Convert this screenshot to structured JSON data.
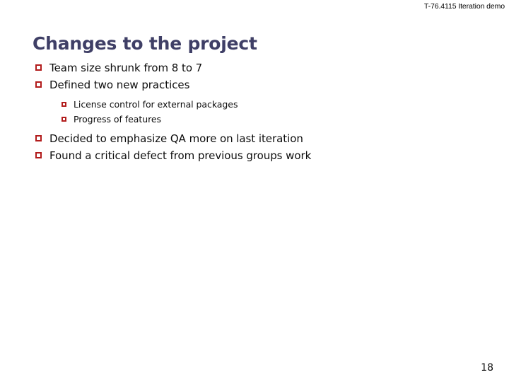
{
  "slide": {
    "header": "T-76.4115 Iteration demo",
    "title": "Changes to the project",
    "page_number": "18",
    "colors": {
      "title": "#3f3f66",
      "bullet_marker": "#b21c1c",
      "body_text": "#0d0d0d",
      "background": "#ffffff"
    },
    "bullets": [
      {
        "level": 1,
        "marker": "hollow-square",
        "text": "Team size shrunk from 8 to 7"
      },
      {
        "level": 1,
        "marker": "hollow-square",
        "text": "Defined two new practices"
      },
      {
        "level": 2,
        "marker": "hollow-square",
        "text": "License control for external packages"
      },
      {
        "level": 2,
        "marker": "hollow-square",
        "text": "Progress of features"
      },
      {
        "level": 1,
        "marker": "hollow-square",
        "text": "Decided to emphasize QA more on last iteration"
      },
      {
        "level": 1,
        "marker": "hollow-square",
        "text": "Found a critical defect from previous groups work"
      }
    ]
  }
}
